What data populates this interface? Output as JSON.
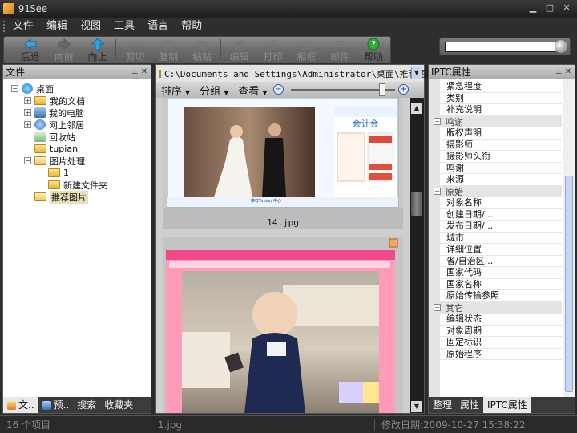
{
  "window": {
    "title": "91See"
  },
  "menu": [
    "文件",
    "编辑",
    "视图",
    "工具",
    "语言",
    "帮助"
  ],
  "toolbar": {
    "buttons": [
      {
        "label": "后退",
        "icon": "back-arrow-icon",
        "enabled": true,
        "color": "#3aa0e0"
      },
      {
        "label": "向前",
        "icon": "forward-arrow-icon",
        "enabled": false
      },
      {
        "label": "向上",
        "icon": "up-arrow-icon",
        "enabled": true,
        "color": "#2aa3e8"
      },
      {
        "label": "剪切",
        "icon": "scissors-icon",
        "enabled": false
      },
      {
        "label": "复制",
        "icon": "copy-icon",
        "enabled": false
      },
      {
        "label": "粘贴",
        "icon": "paste-icon",
        "enabled": false
      },
      {
        "label": "编辑",
        "icon": "edit-icon",
        "enabled": false
      },
      {
        "label": "打印",
        "icon": "printer-icon",
        "enabled": false
      },
      {
        "label": "相框",
        "icon": "frame-icon",
        "enabled": false
      },
      {
        "label": "邮件",
        "icon": "mail-icon",
        "enabled": false
      },
      {
        "label": "帮助",
        "icon": "help-icon",
        "enabled": true,
        "color": "#2faa3a"
      }
    ],
    "search_value": ""
  },
  "left_panel": {
    "title": "文件",
    "tree": [
      {
        "label": "桌面",
        "icon": "desktop-icon",
        "expand": "-"
      },
      {
        "label": "我的文档",
        "icon": "folder-icon",
        "expand": "+"
      },
      {
        "label": "我的电脑",
        "icon": "computer-icon",
        "expand": "+"
      },
      {
        "label": "网上邻居",
        "icon": "network-icon",
        "expand": "+"
      },
      {
        "label": "回收站",
        "icon": "recycle-bin-icon",
        "expand": ""
      },
      {
        "label": "tupian",
        "icon": "folder-icon",
        "expand": ""
      },
      {
        "label": "图片处理",
        "icon": "folder-icon",
        "expand": "-"
      },
      {
        "label": "1",
        "icon": "folder-icon",
        "expand": ""
      },
      {
        "label": "新建文件夹",
        "icon": "folder-icon",
        "expand": ""
      },
      {
        "label": "推荐图片",
        "icon": "folder-open-icon",
        "expand": "",
        "selected": true
      }
    ],
    "tabs": [
      "文..",
      "预..",
      "搜索",
      "收藏夹"
    ]
  },
  "center": {
    "path": "C:\\Documents and Settings\\Administrator\\桌面\\推荐图片",
    "view_menu": [
      "排序",
      "分组",
      "查看"
    ],
    "zoom_level": 0.88,
    "thumbnails": [
      {
        "filename": "14.jpg",
        "web_header": "会计会",
        "banner": "推荐Tupian 中心"
      },
      {
        "filename": ""
      }
    ]
  },
  "right_panel": {
    "title": "IPTC属性",
    "groups": [
      {
        "name": "",
        "items": [
          "紧急程度",
          "类别",
          "补充说明"
        ]
      },
      {
        "name": "鸣谢",
        "items": [
          "版权声明",
          "摄影师",
          "摄影师头衔",
          "鸣谢",
          "来源"
        ]
      },
      {
        "name": "原始",
        "items": [
          "对象名称",
          "创建日期/...",
          "发布日期/...",
          "城市",
          "详细位置",
          "省/自治区...",
          "国家代码",
          "国家名称",
          "原始传输参照"
        ]
      },
      {
        "name": "其它",
        "items": [
          "编辑状态",
          "对象周期",
          "固定标识",
          "原始程序"
        ]
      }
    ],
    "tabs": [
      "整理",
      "属性",
      "IPTC属性"
    ]
  },
  "status": {
    "count": "16 个项目",
    "selected_file": "1.jpg",
    "modified": "修改日期:2009-10-27 15:38:22"
  }
}
